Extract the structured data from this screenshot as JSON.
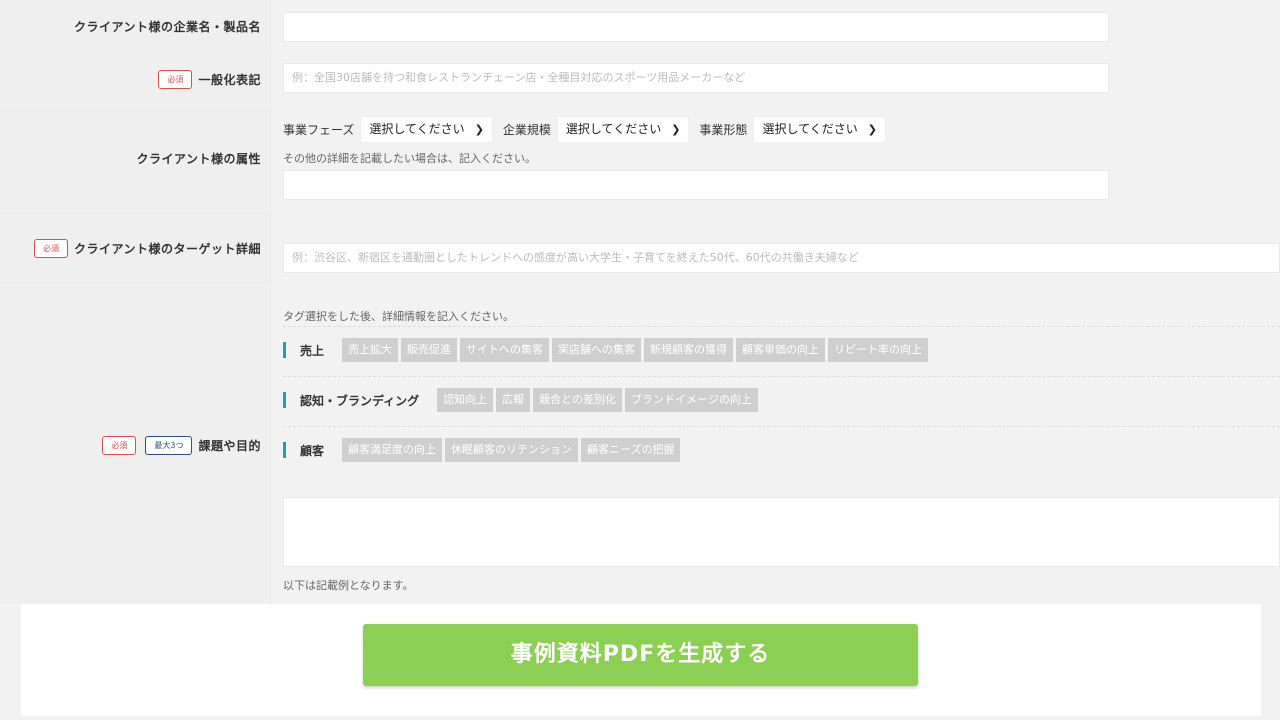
{
  "rows": {
    "company": {
      "label": "クライアント様の企業名・製品名",
      "value": ""
    },
    "general": {
      "badge": "必須",
      "label": "一般化表記",
      "placeholder": "例：全国30店舗を持つ和食レストランチェーン店・全種目対応のスポーツ用品メーカーなど"
    },
    "attributes": {
      "label": "クライアント様の属性",
      "selects": [
        {
          "label": "事業フェーズ",
          "value": "選択してください"
        },
        {
          "label": "企業規模",
          "value": "選択してください"
        },
        {
          "label": "事業形態",
          "value": "選択してください"
        }
      ],
      "hint": "その他の詳細を記載したい場合は、記入ください。",
      "value": ""
    },
    "target": {
      "badge": "必須",
      "label": "クライアント様のターゲット詳細",
      "placeholder": "例：渋谷区、新宿区を通勤圏としたトレンドへの感度が高い大学生・子育てを終えた50代、60代の共働き夫婦など"
    },
    "goals": {
      "badge_required": "必須",
      "badge_max": "最大3つ",
      "label": "課題や目的",
      "instruction": "タグ選択をした後、詳細情報を記入ください。",
      "groups": [
        {
          "name": "売上",
          "tags": [
            "売上拡大",
            "販売促進",
            "サイトへの集客",
            "実店舗への集客",
            "新規顧客の獲得",
            "顧客単価の向上",
            "リピート率の向上"
          ]
        },
        {
          "name": "認知・ブランディング",
          "tags": [
            "認知向上",
            "広報",
            "競合との差別化",
            "ブランドイメージの向上"
          ]
        },
        {
          "name": "顧客",
          "tags": [
            "顧客満足度の向上",
            "休眠顧客のリテンション",
            "顧客ニーズの把握"
          ]
        }
      ],
      "footnote": "以下は記載例となります。"
    }
  },
  "generate_button": "事例資料PDFを生成する",
  "colors": {
    "accent_bar": "#2a9fa3",
    "generate_button": "#8bcf53",
    "required_badge": "#d9534f",
    "max_badge": "#2c4f8a"
  }
}
